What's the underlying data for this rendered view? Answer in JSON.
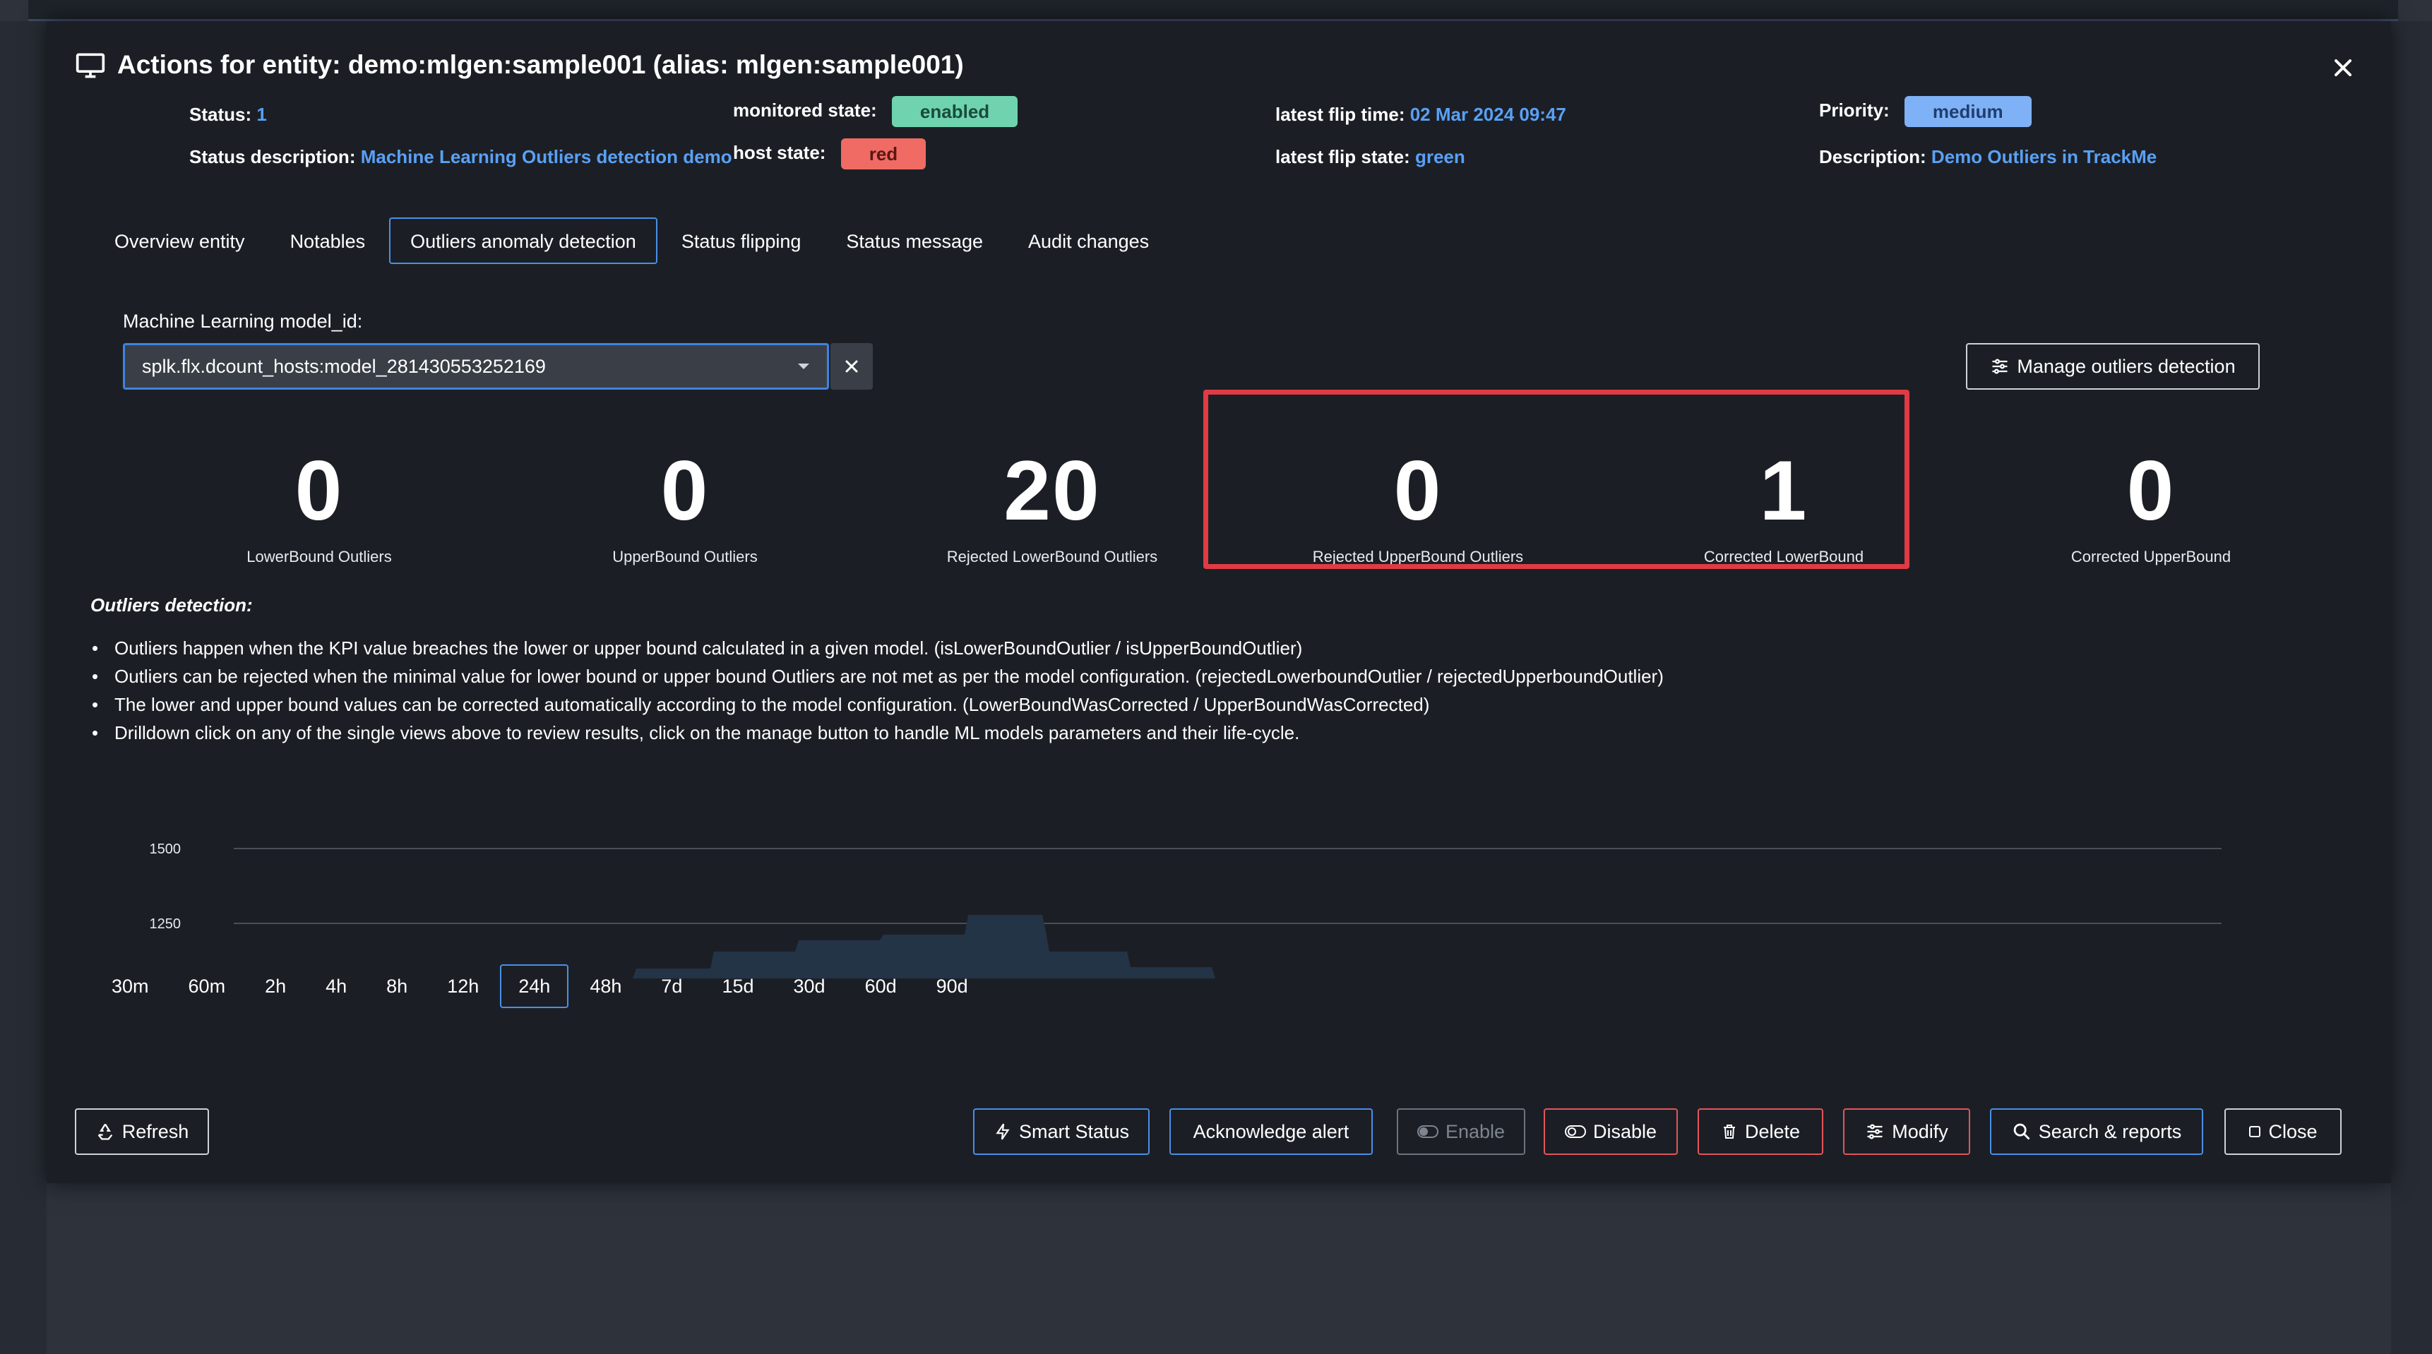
{
  "modal": {
    "title": "Actions for entity: demo:mlgen:sample001 (alias: mlgen:sample001)"
  },
  "meta": {
    "status_label": "Status:",
    "status_value": "1",
    "status_desc_label": "Status description:",
    "status_desc_value": "Machine Learning Outliers detection demo",
    "monitored_state_label": "monitored state:",
    "monitored_state_value": "enabled",
    "host_state_label": "host state:",
    "host_state_value": "red",
    "latest_flip_time_label": "latest flip time:",
    "latest_flip_time_value": "02 Mar 2024 09:47",
    "latest_flip_state_label": "latest flip state:",
    "latest_flip_state_value": "green",
    "priority_label": "Priority:",
    "priority_value": "medium",
    "description_label": "Description:",
    "description_value": "Demo Outliers in TrackMe"
  },
  "tabs": [
    {
      "label": "Overview entity"
    },
    {
      "label": "Notables"
    },
    {
      "label": "Outliers anomaly detection"
    },
    {
      "label": "Status flipping"
    },
    {
      "label": "Status message"
    },
    {
      "label": "Audit changes"
    }
  ],
  "model": {
    "label": "Machine Learning model_id:",
    "selected": "splk.flx.dcount_hosts:model_281430553252169"
  },
  "manage_button": "Manage outliers detection",
  "singles": [
    {
      "value": "0",
      "label": "LowerBound Outliers"
    },
    {
      "value": "0",
      "label": "UpperBound Outliers"
    },
    {
      "value": "20",
      "label": "Rejected LowerBound Outliers"
    },
    {
      "value": "0",
      "label": "Rejected UpperBound Outliers"
    },
    {
      "value": "1",
      "label": "Corrected LowerBound"
    },
    {
      "value": "0",
      "label": "Corrected UpperBound"
    }
  ],
  "outliers_detection": {
    "title": "Outliers detection:",
    "items": [
      "Outliers happen when the KPI value breaches the lower or upper bound calculated in a given model. (isLowerBoundOutlier / isUpperBoundOutlier)",
      "Outliers can be rejected when the minimal value for lower bound or upper bound Outliers are not met as per the model configuration. (rejectedLowerboundOutlier / rejectedUpperboundOutlier)",
      "The lower and upper bound values can be corrected automatically according to the model configuration. (LowerBoundWasCorrected / UpperBoundWasCorrected)",
      "Drilldown click on any of the single views above to review results, click on the manage button to handle ML models parameters and their life-cycle."
    ]
  },
  "chart": {
    "y_ticks": [
      "1500",
      "1250"
    ]
  },
  "time_ranges": [
    {
      "label": "30m"
    },
    {
      "label": "60m"
    },
    {
      "label": "2h"
    },
    {
      "label": "4h"
    },
    {
      "label": "8h"
    },
    {
      "label": "12h"
    },
    {
      "label": "24h"
    },
    {
      "label": "48h"
    },
    {
      "label": "7d"
    },
    {
      "label": "15d"
    },
    {
      "label": "30d"
    },
    {
      "label": "60d"
    },
    {
      "label": "90d"
    }
  ],
  "footer": {
    "refresh": "Refresh",
    "smart_status": "Smart Status",
    "acknowledge": "Acknowledge alert",
    "enable": "Enable",
    "disable": "Disable",
    "delete": "Delete",
    "modify": "Modify",
    "search_reports": "Search & reports",
    "close": "Close"
  },
  "colors": {
    "accent": "#4a8fe8",
    "danger": "#e03b45",
    "link": "#5aa0f5",
    "modal_bg": "#1b1f25"
  }
}
